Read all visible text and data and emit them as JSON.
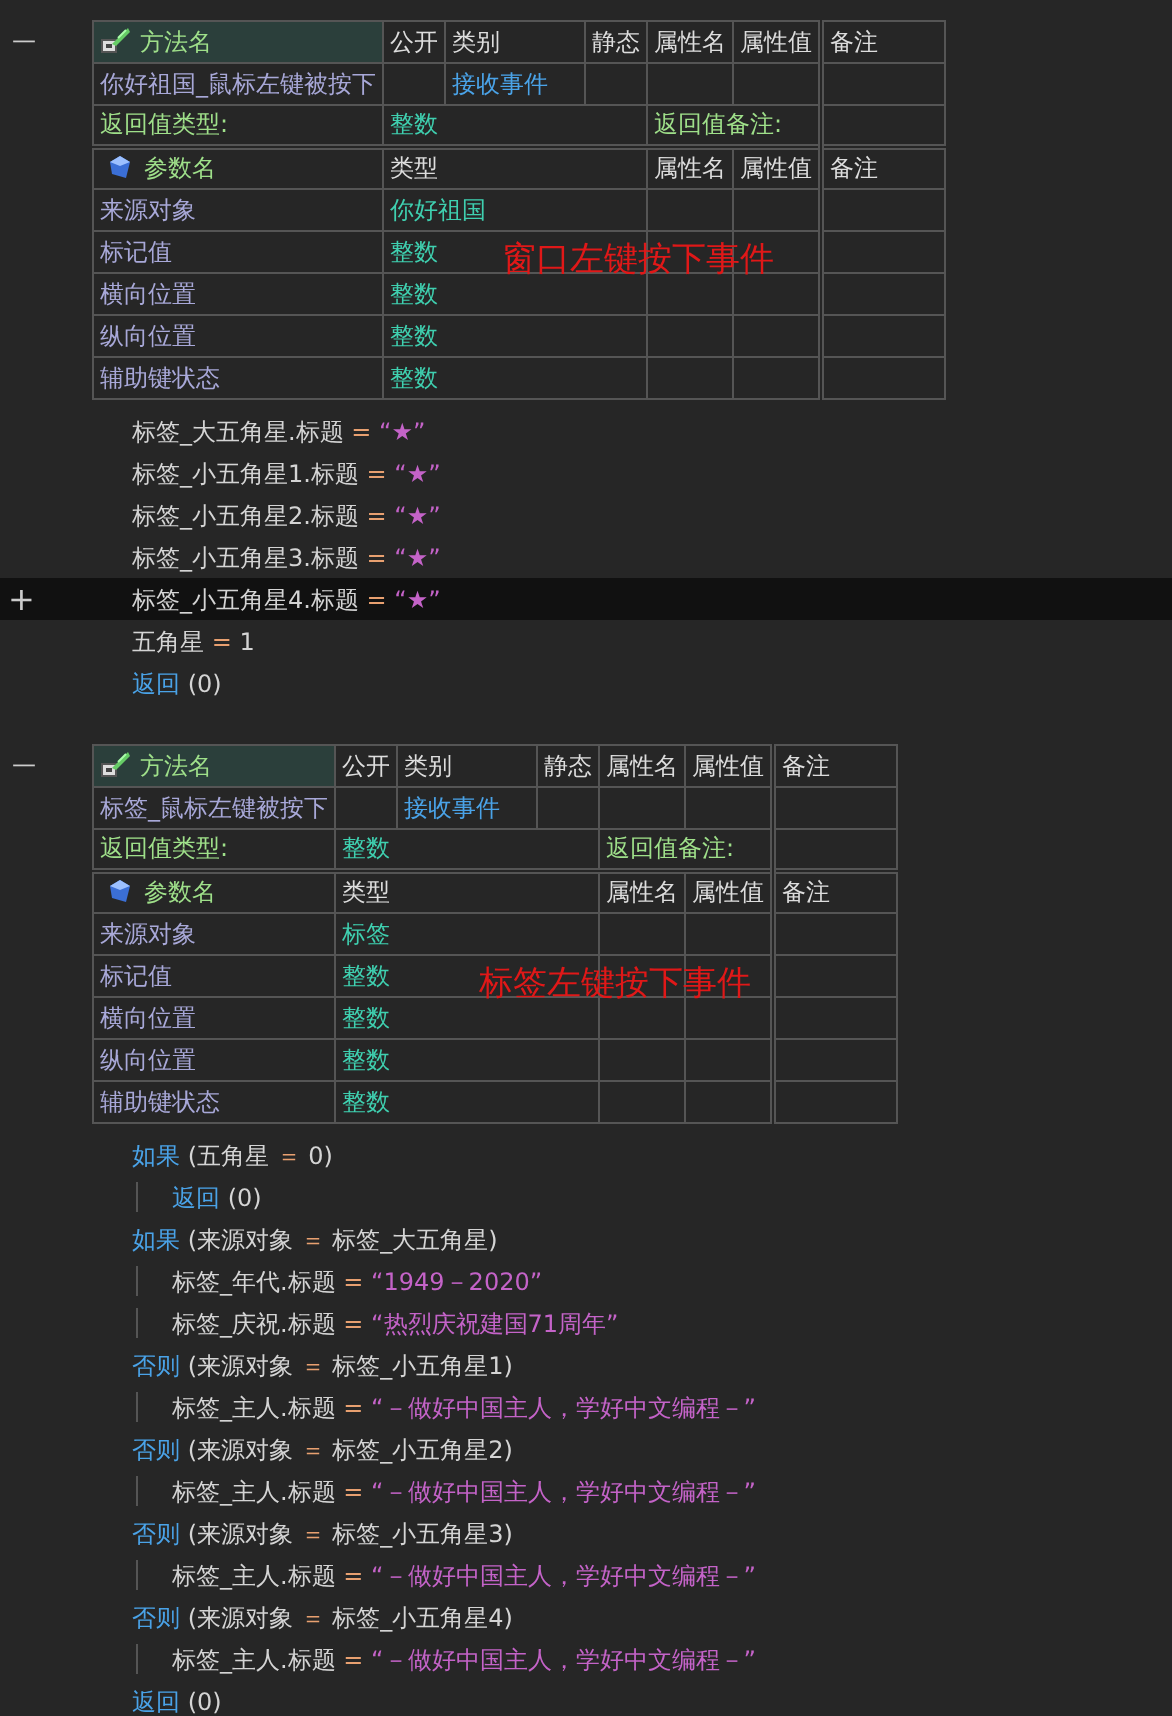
{
  "methods": [
    {
      "fold_marker": "—",
      "overlay_note": "窗口左键按下事件",
      "table": {
        "headers": [
          "方法名",
          "公开",
          "类别",
          "静态",
          "属性名",
          "属性值",
          "备注"
        ],
        "name": "你好祖国_鼠标左键被按下",
        "category": "接收事件",
        "return_label": "返回值类型:",
        "return_type": "整数",
        "return_note_label": "返回值备注:",
        "param_headers": [
          "参数名",
          "类型",
          "属性名",
          "属性值",
          "备注"
        ],
        "params": [
          {
            "name": "来源对象",
            "type": "你好祖国"
          },
          {
            "name": "标记值",
            "type": "整数"
          },
          {
            "name": "横向位置",
            "type": "整数"
          },
          {
            "name": "纵向位置",
            "type": "整数"
          },
          {
            "name": "辅助键状态",
            "type": "整数"
          }
        ]
      },
      "code": [
        {
          "current": false,
          "tokens": [
            {
              "kind": "plain",
              "text": "标签_大五角星.标题"
            },
            {
              "kind": "op",
              "text": "="
            },
            {
              "kind": "string",
              "text": "“★”"
            }
          ]
        },
        {
          "current": false,
          "tokens": [
            {
              "kind": "plain",
              "text": "标签_小五角星1.标题"
            },
            {
              "kind": "op",
              "text": "="
            },
            {
              "kind": "string",
              "text": "“★”"
            }
          ]
        },
        {
          "current": false,
          "tokens": [
            {
              "kind": "plain",
              "text": "标签_小五角星2.标题"
            },
            {
              "kind": "op",
              "text": "="
            },
            {
              "kind": "string",
              "text": "“★”"
            }
          ]
        },
        {
          "current": false,
          "tokens": [
            {
              "kind": "plain",
              "text": "标签_小五角星3.标题"
            },
            {
              "kind": "op",
              "text": "="
            },
            {
              "kind": "string",
              "text": "“★”"
            }
          ]
        },
        {
          "current": true,
          "gutter": "+",
          "tokens": [
            {
              "kind": "plain",
              "text": "标签_小五角星4.标题"
            },
            {
              "kind": "op",
              "text": "="
            },
            {
              "kind": "string",
              "text": "“★”"
            }
          ]
        },
        {
          "current": false,
          "tokens": [
            {
              "kind": "plain",
              "text": "五角星"
            },
            {
              "kind": "op",
              "text": "="
            },
            {
              "kind": "plain",
              "text": "1"
            }
          ]
        },
        {
          "current": false,
          "tokens": [
            {
              "kind": "keyword",
              "text": "返回"
            },
            {
              "kind": "plain",
              "text": "(0)"
            }
          ]
        }
      ]
    },
    {
      "fold_marker": "—",
      "overlay_note": "标签左键按下事件",
      "table": {
        "headers": [
          "方法名",
          "公开",
          "类别",
          "静态",
          "属性名",
          "属性值",
          "备注"
        ],
        "name": "标签_鼠标左键被按下",
        "category": "接收事件",
        "return_label": "返回值类型:",
        "return_type": "整数",
        "return_note_label": "返回值备注:",
        "param_headers": [
          "参数名",
          "类型",
          "属性名",
          "属性值",
          "备注"
        ],
        "params": [
          {
            "name": "来源对象",
            "type": "标签"
          },
          {
            "name": "标记值",
            "type": "整数"
          },
          {
            "name": "横向位置",
            "type": "整数"
          },
          {
            "name": "纵向位置",
            "type": "整数"
          },
          {
            "name": "辅助键状态",
            "type": "整数"
          }
        ]
      },
      "code": [
        {
          "current": false,
          "tokens": [
            {
              "kind": "keyword",
              "text": "如果"
            },
            {
              "kind": "plain",
              "text": "(五角星"
            },
            {
              "kind": "op",
              "text": "＝"
            },
            {
              "kind": "plain",
              "text": "0)"
            }
          ],
          "children": [
            {
              "current": false,
              "tokens": [
                {
                  "kind": "keyword",
                  "text": "返回"
                },
                {
                  "kind": "plain",
                  "text": "(0)"
                }
              ]
            }
          ]
        },
        {
          "current": false,
          "tokens": [
            {
              "kind": "keyword",
              "text": "如果"
            },
            {
              "kind": "plain",
              "text": "(来源对象"
            },
            {
              "kind": "op",
              "text": "＝"
            },
            {
              "kind": "plain",
              "text": "标签_大五角星)"
            }
          ],
          "children": [
            {
              "current": false,
              "tokens": [
                {
                  "kind": "plain",
                  "text": "标签_年代.标题"
                },
                {
                  "kind": "op",
                  "text": "="
                },
                {
                  "kind": "string",
                  "text": "“1949－2020”"
                }
              ]
            },
            {
              "current": false,
              "tokens": [
                {
                  "kind": "plain",
                  "text": "标签_庆祝.标题"
                },
                {
                  "kind": "op",
                  "text": "="
                },
                {
                  "kind": "string",
                  "text": "“热烈庆祝建国71周年”"
                }
              ]
            }
          ]
        },
        {
          "current": false,
          "tokens": [
            {
              "kind": "keyword",
              "text": "否则"
            },
            {
              "kind": "plain",
              "text": "(来源对象"
            },
            {
              "kind": "op",
              "text": "＝"
            },
            {
              "kind": "plain",
              "text": "标签_小五角星1)"
            }
          ],
          "children": [
            {
              "current": false,
              "tokens": [
                {
                  "kind": "plain",
                  "text": "标签_主人.标题"
                },
                {
                  "kind": "op",
                  "text": "="
                },
                {
                  "kind": "string",
                  "text": "“－做好中国主人，学好中文编程－”"
                }
              ]
            }
          ]
        },
        {
          "current": false,
          "tokens": [
            {
              "kind": "keyword",
              "text": "否则"
            },
            {
              "kind": "plain",
              "text": "(来源对象"
            },
            {
              "kind": "op",
              "text": "＝"
            },
            {
              "kind": "plain",
              "text": "标签_小五角星2)"
            }
          ],
          "children": [
            {
              "current": false,
              "tokens": [
                {
                  "kind": "plain",
                  "text": "标签_主人.标题"
                },
                {
                  "kind": "op",
                  "text": "="
                },
                {
                  "kind": "string",
                  "text": "“－做好中国主人，学好中文编程－”"
                }
              ]
            }
          ]
        },
        {
          "current": false,
          "tokens": [
            {
              "kind": "keyword",
              "text": "否则"
            },
            {
              "kind": "plain",
              "text": "(来源对象"
            },
            {
              "kind": "op",
              "text": "＝"
            },
            {
              "kind": "plain",
              "text": "标签_小五角星3)"
            }
          ],
          "children": [
            {
              "current": false,
              "tokens": [
                {
                  "kind": "plain",
                  "text": "标签_主人.标题"
                },
                {
                  "kind": "op",
                  "text": "="
                },
                {
                  "kind": "string",
                  "text": "“－做好中国主人，学好中文编程－”"
                }
              ]
            }
          ]
        },
        {
          "current": false,
          "tokens": [
            {
              "kind": "keyword",
              "text": "否则"
            },
            {
              "kind": "plain",
              "text": "(来源对象"
            },
            {
              "kind": "op",
              "text": "＝"
            },
            {
              "kind": "plain",
              "text": "标签_小五角星4)"
            }
          ],
          "children": [
            {
              "current": false,
              "tokens": [
                {
                  "kind": "plain",
                  "text": "标签_主人.标题"
                },
                {
                  "kind": "op",
                  "text": "="
                },
                {
                  "kind": "string",
                  "text": "“－做好中国主人，学好中文编程－”"
                }
              ]
            }
          ]
        },
        {
          "current": false,
          "tokens": [
            {
              "kind": "keyword",
              "text": "返回"
            },
            {
              "kind": "plain",
              "text": "(0)"
            }
          ]
        }
      ]
    }
  ]
}
